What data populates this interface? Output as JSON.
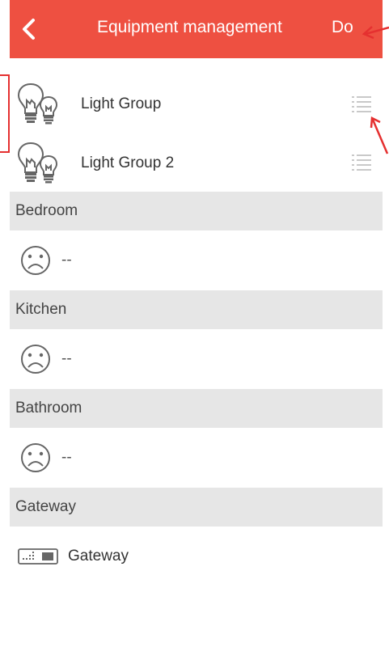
{
  "header": {
    "title": "Equipment management",
    "done_label": "Do",
    "accent_color": "#ee5041"
  },
  "groups": [
    {
      "label": "Light Group",
      "icon": "light-bulbs-icon",
      "action_icon": "menu-lines-icon"
    },
    {
      "label": "Light Group 2",
      "icon": "light-bulbs-icon",
      "action_icon": "menu-lines-icon"
    }
  ],
  "sections": [
    {
      "title": "Bedroom",
      "items": [
        {
          "label": "--",
          "icon": "sad-face-icon"
        }
      ]
    },
    {
      "title": "Kitchen",
      "items": [
        {
          "label": "--",
          "icon": "sad-face-icon"
        }
      ]
    },
    {
      "title": "Bathroom",
      "items": [
        {
          "label": "--",
          "icon": "sad-face-icon"
        }
      ]
    },
    {
      "title": "Gateway",
      "items": [
        {
          "label": "Gateway",
          "icon": "gateway-device-icon"
        }
      ]
    }
  ],
  "annotation_color": "#e53030"
}
